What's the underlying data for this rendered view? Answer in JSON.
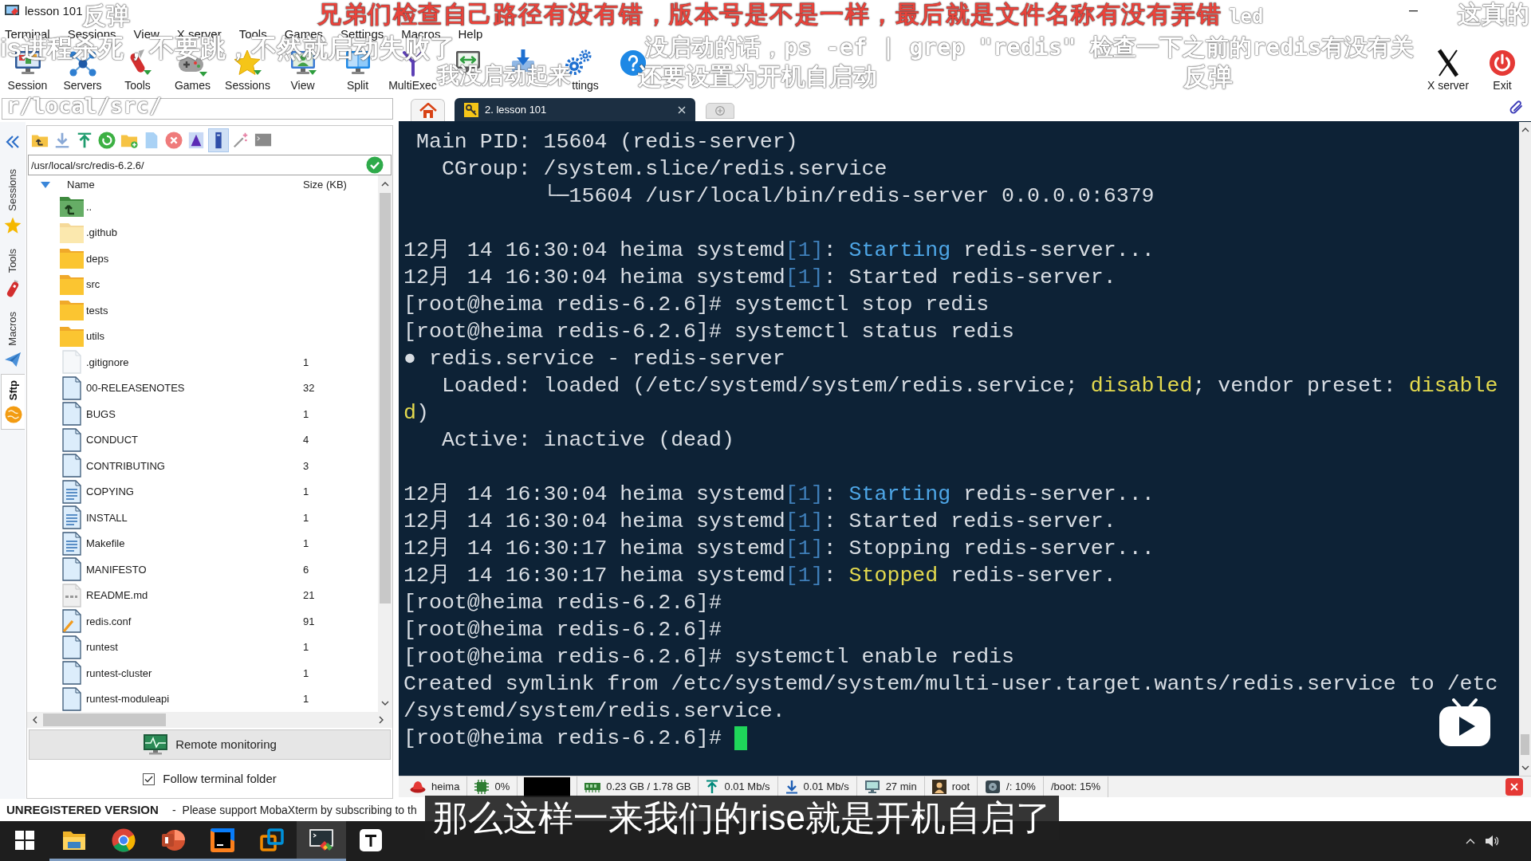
{
  "window": {
    "title": "lesson 101"
  },
  "menu": [
    "Terminal",
    "Sessions",
    "View",
    "X server",
    "Tools",
    "Games",
    "Settings",
    "Macros",
    "Help"
  ],
  "toolbar": {
    "left": [
      {
        "label": "Session",
        "kind": "session"
      },
      {
        "label": "Servers",
        "kind": "servers"
      },
      {
        "label": "Tools",
        "kind": "tools"
      },
      {
        "label": "Games",
        "kind": "games"
      },
      {
        "label": "Sessions",
        "kind": "sessions"
      },
      {
        "label": "View",
        "kind": "view"
      },
      {
        "label": "Split",
        "kind": "split"
      },
      {
        "label": "MultiExec",
        "kind": "multiexec"
      },
      {
        "kind": "tunneling"
      },
      {
        "kind": "packages"
      },
      {
        "label": "ttings",
        "kind": "settings"
      },
      {
        "kind": "help"
      }
    ],
    "right": [
      {
        "label": "X server",
        "kind": "xserver"
      },
      {
        "label": "Exit",
        "kind": "exit"
      }
    ]
  },
  "side_tabs": [
    {
      "label": "Sessions",
      "kind": "sessions",
      "selected": false
    },
    {
      "label": "Tools",
      "kind": "tools",
      "selected": false
    },
    {
      "label": "Macros",
      "kind": "macros",
      "selected": false
    },
    {
      "label": "Sftp",
      "kind": "sftp",
      "selected": true
    }
  ],
  "sftp": {
    "toolbar": [
      {
        "kind": "parent",
        "pressed": false
      },
      {
        "kind": "download",
        "pressed": false
      },
      {
        "kind": "upload",
        "pressed": false
      },
      {
        "kind": "refresh",
        "pressed": false
      },
      {
        "kind": "newfolder",
        "pressed": false
      },
      {
        "kind": "newfile",
        "pressed": false
      },
      {
        "kind": "delete",
        "pressed": false
      },
      {
        "kind": "rename",
        "pressed": false
      },
      {
        "kind": "hidden",
        "pressed": true
      },
      {
        "kind": "wand",
        "pressed": false
      },
      {
        "kind": "terminal",
        "pressed": false
      }
    ],
    "path": "/usr/local/src/redis-6.2.6/",
    "columns": [
      "Name",
      "Size (KB)"
    ],
    "files": [
      {
        "name": "..",
        "kind": "parent"
      },
      {
        "name": ".github",
        "kind": "hiddenfolder"
      },
      {
        "name": "deps",
        "kind": "folder"
      },
      {
        "name": "src",
        "kind": "folder"
      },
      {
        "name": "tests",
        "kind": "folder"
      },
      {
        "name": "utils",
        "kind": "folder"
      },
      {
        "name": ".gitignore",
        "size": "1",
        "kind": "hiddenfile"
      },
      {
        "name": "00-RELEASENOTES",
        "size": "32",
        "kind": "file"
      },
      {
        "name": "BUGS",
        "size": "1",
        "kind": "file"
      },
      {
        "name": "CONDUCT",
        "size": "4",
        "kind": "file"
      },
      {
        "name": "CONTRIBUTING",
        "size": "3",
        "kind": "file"
      },
      {
        "name": "COPYING",
        "size": "1",
        "kind": "textfile"
      },
      {
        "name": "INSTALL",
        "size": "1",
        "kind": "textfile"
      },
      {
        "name": "Makefile",
        "size": "1",
        "kind": "textfile"
      },
      {
        "name": "MANIFESTO",
        "size": "6",
        "kind": "file"
      },
      {
        "name": "README.md",
        "size": "21",
        "kind": "markdown"
      },
      {
        "name": "redis.conf",
        "size": "91",
        "kind": "config"
      },
      {
        "name": "runtest",
        "size": "1",
        "kind": "file"
      },
      {
        "name": "runtest-cluster",
        "size": "1",
        "kind": "file"
      },
      {
        "name": "runtest-moduleapi",
        "size": "1",
        "kind": "file"
      }
    ],
    "remote_monitoring": "Remote monitoring",
    "follow_terminal_folder": {
      "label": "Follow terminal folder",
      "checked": true
    }
  },
  "session_tabs": [
    {
      "label": "2. lesson 101",
      "selected": true
    }
  ],
  "terminal": {
    "blocks": [
      {
        "lines": [
          {
            "segments": [
              {
                "text": " Main PID: 15604 (redis-server)"
              }
            ]
          },
          {
            "segments": [
              {
                "text": "   CGroup: /system.slice/redis.service"
              }
            ]
          },
          {
            "segments": [
              {
                "text": "           └─15604 /usr/local/bin/redis-server 0.0.0.0:6379"
              }
            ]
          }
        ]
      },
      {
        "lines": [
          {
            "segments": [
              {
                "text": "12月 14 16:30:04 heima systemd"
              },
              {
                "text": "[1]",
                "color": "#3f7fb9"
              },
              {
                "text": ": "
              },
              {
                "text": "Starting",
                "color": "#4ea6e6"
              },
              {
                "text": " redis-server..."
              }
            ]
          },
          {
            "segments": [
              {
                "text": "12月 14 16:30:04 heima systemd"
              },
              {
                "text": "[1]",
                "color": "#3f7fb9"
              },
              {
                "text": ": Started redis-server."
              }
            ]
          },
          {
            "segments": [
              {
                "text": "[root@heima redis-6.2.6]# systemctl stop redis"
              }
            ]
          },
          {
            "segments": [
              {
                "text": "[root@heima redis-6.2.6]# systemctl status redis"
              }
            ]
          },
          {
            "segments": [
              {
                "text": "● redis.service - redis-server"
              }
            ]
          },
          {
            "segments": [
              {
                "text": "   Loaded: loaded (/etc/systemd/system/redis.service; "
              },
              {
                "text": "disabled",
                "color": "#e4da4e"
              },
              {
                "text": "; vendor preset: "
              },
              {
                "text": "disable",
                "color": "#e4da4e"
              }
            ]
          },
          {
            "segments": [
              {
                "text": "d",
                "color": "#e4da4e"
              },
              {
                "text": ")"
              }
            ]
          },
          {
            "segments": [
              {
                "text": "   Active: inactive (dead)"
              }
            ]
          }
        ]
      },
      {
        "lines": [
          {
            "segments": [
              {
                "text": "12月 14 16:30:04 heima systemd"
              },
              {
                "text": "[1]",
                "color": "#3f7fb9"
              },
              {
                "text": ": "
              },
              {
                "text": "Starting",
                "color": "#4ea6e6"
              },
              {
                "text": " redis-server..."
              }
            ]
          },
          {
            "segments": [
              {
                "text": "12月 14 16:30:04 heima systemd"
              },
              {
                "text": "[1]",
                "color": "#3f7fb9"
              },
              {
                "text": ": Started redis-server."
              }
            ]
          },
          {
            "segments": [
              {
                "text": "12月 14 16:30:17 heima systemd"
              },
              {
                "text": "[1]",
                "color": "#3f7fb9"
              },
              {
                "text": ": Stopping redis-server..."
              }
            ]
          },
          {
            "segments": [
              {
                "text": "12月 14 16:30:17 heima systemd"
              },
              {
                "text": "[1]",
                "color": "#3f7fb9"
              },
              {
                "text": ": "
              },
              {
                "text": "Stopped",
                "color": "#e4da4e"
              },
              {
                "text": " redis-server."
              }
            ]
          },
          {
            "segments": [
              {
                "text": "[root@heima redis-6.2.6]#"
              }
            ]
          },
          {
            "segments": [
              {
                "text": "[root@heima redis-6.2.6]#"
              }
            ]
          },
          {
            "segments": [
              {
                "text": "[root@heima redis-6.2.6]# systemctl enable redis"
              }
            ]
          },
          {
            "segments": [
              {
                "text": "Created symlink from /etc/systemd/system/multi-user.target.wants/redis.service to /etc"
              }
            ]
          },
          {
            "segments": [
              {
                "text": "/systemd/system/redis.service."
              }
            ]
          },
          {
            "segments": [
              {
                "text": "[root@heima redis-6.2.6]#"
              }
            ]
          }
        ]
      }
    ]
  },
  "status_bar": [
    {
      "kind": "host",
      "text": "heima"
    },
    {
      "kind": "cpu",
      "text": "0%"
    },
    {
      "kind": "redacted"
    },
    {
      "kind": "memory",
      "text": "0.23 GB / 1.78 GB"
    },
    {
      "kind": "upload",
      "text": "0.01 Mb/s"
    },
    {
      "kind": "download",
      "text": "0.01 Mb/s"
    },
    {
      "kind": "uptime",
      "text": "27 min"
    },
    {
      "kind": "user",
      "text": "root"
    },
    {
      "kind": "disk",
      "text": "/: 10%"
    },
    {
      "kind": "plain",
      "text": "/boot: 15%"
    }
  ],
  "footer": {
    "edition": "UNREGISTERED VERSION",
    "separator": "-",
    "message": "Please support MobaXterm by subscribing to th"
  },
  "taskbar": [
    {
      "kind": "start",
      "running": false,
      "selected": false
    },
    {
      "kind": "explorer",
      "running": true,
      "selected": false
    },
    {
      "kind": "browser",
      "running": true,
      "selected": false
    },
    {
      "kind": "slides",
      "running": true,
      "selected": false
    },
    {
      "kind": "ide",
      "running": true,
      "selected": false
    },
    {
      "kind": "vm",
      "running": true,
      "selected": false
    },
    {
      "kind": "terminal",
      "running": true,
      "selected": true
    },
    {
      "kind": "editor",
      "running": false,
      "selected": false
    }
  ],
  "overlay": {
    "danmaku": [
      {
        "text": "反弹",
        "color": "#ffffff"
      },
      {
        "text": "兄弟们检查自己路径有没有错，版本号是不是一样，最后就是文件名称有没有弄错",
        "color": "#e8433b"
      },
      {
        "text": "led",
        "color": "#ffffff"
      },
      {
        "text": "这真的",
        "color": "#ffffff"
      },
      {
        "text": "is进程杀死，不要跳，不然就启动失败了",
        "color": "#ffffff"
      },
      {
        "text": "没启动的话，ps -ef | grep \"redis\" 检查一下之前的redis有没有关",
        "color": "#ffffff"
      },
      {
        "text": "我没启动起来",
        "color": "#ffffff"
      },
      {
        "text": "还要设置为开机自启动",
        "color": "#ffffff"
      },
      {
        "text": "反弹",
        "color": "#ffffff"
      },
      {
        "text": "r/local/src/",
        "color": "#ffffff"
      }
    ],
    "subtitle": "那么这样一来我们的rise就是开机自启了"
  }
}
